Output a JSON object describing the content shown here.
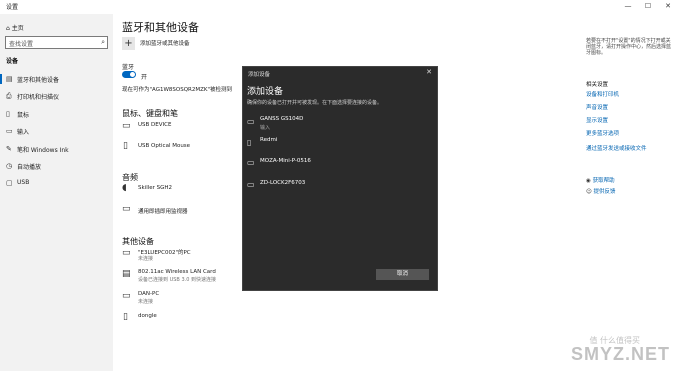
{
  "window": {
    "title": "设置",
    "minimize": "—",
    "maximize": "☐",
    "close": "✕"
  },
  "sidebar": {
    "home": "主页",
    "search_placeholder": "查找设置",
    "section": "设备",
    "items": [
      {
        "label": "蓝牙和其他设备",
        "icon": "bluetooth-icon"
      },
      {
        "label": "打印机和扫描仪",
        "icon": "printer-icon"
      },
      {
        "label": "鼠标",
        "icon": "mouse-icon"
      },
      {
        "label": "输入",
        "icon": "keyboard-icon"
      },
      {
        "label": "笔和 Windows Ink",
        "icon": "pen-icon"
      },
      {
        "label": "自动播放",
        "icon": "autoplay-icon"
      },
      {
        "label": "USB",
        "icon": "usb-icon"
      }
    ]
  },
  "main": {
    "title": "蓝牙和其他设备",
    "add_device": "添加蓝牙或其他设备",
    "bluetooth_label": "蓝牙",
    "bluetooth_state": "开",
    "discoverable": "现在可作为\"AG1W8SOSQR2MZK\"被检测到",
    "mouse_section": "鼠标、键盘和笔",
    "mouse_devices": [
      {
        "name": "USB DEVICE",
        "sub": ""
      },
      {
        "name": "USB Optical Mouse",
        "sub": ""
      }
    ],
    "audio_section": "音频",
    "audio_devices": [
      {
        "name": "Skiller SGH2",
        "sub": ""
      },
      {
        "name": "通用即插即用监视器",
        "sub": ""
      }
    ],
    "other_section": "其他设备",
    "other_devices": [
      {
        "name": "\"E3LUEPC002\"的PC",
        "sub": "未连接"
      },
      {
        "name": "802.11ac Wireless LAN Card",
        "sub": "设备已连接到 USB 3.0 到快速连接"
      },
      {
        "name": "DAN-PC",
        "sub": "未连接"
      },
      {
        "name": "dongle",
        "sub": ""
      }
    ]
  },
  "right_panel": {
    "intro": "若要在不打开\"设置\"的情况下打开或关闭蓝牙，请打开操作中心，然后选择蓝牙图标。",
    "related_heading": "相关设置",
    "links": [
      "设备和打印机",
      "声音设置",
      "显示设置",
      "更多蓝牙选项",
      "通过蓝牙发送或接收文件"
    ],
    "help": "获取帮助",
    "feedback": "提供反馈"
  },
  "dialog": {
    "title": "添加设备",
    "heading": "添加设备",
    "subtitle": "确保你的设备已打开并可被发现。在下面选择要连接的设备。",
    "devices": [
      {
        "name": "GANSS GS104D",
        "sub": "输入",
        "icon": "keyboard-icon"
      },
      {
        "name": "Redmi",
        "sub": "",
        "icon": "phone-icon"
      },
      {
        "name": "MOZA-Mini-P-0516",
        "sub": "",
        "icon": "display-icon"
      },
      {
        "name": "ZD-LOCK2F6703",
        "sub": "",
        "icon": "display-icon"
      }
    ],
    "cancel": "取消"
  },
  "watermark": {
    "small": "值 什么值得买",
    "big": "SMYZ.NET"
  }
}
